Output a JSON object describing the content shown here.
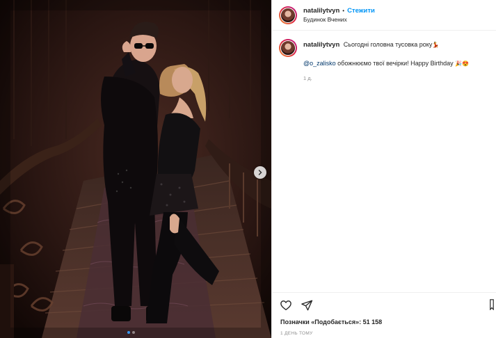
{
  "post": {
    "author": {
      "username": "natalilytvyn",
      "separator": "•",
      "follow_label": "Стежити",
      "location": "Будинок Вчених"
    },
    "caption": {
      "username": "natalilytvyn",
      "text": "Сьогодні головна тусовка року",
      "text_emoji": "💃",
      "mention": "@o_zalisko",
      "line2_text": " обожнюємо твої вечірки! Happy Birthday ",
      "line2_emoji": "🎉😍",
      "timestamp": "1 д."
    },
    "likes_text": "Позначки «Подобається»: 51 158",
    "date_text": "1 ДЕНЬ ТОМУ",
    "carousel": {
      "current": 1,
      "total": 2
    },
    "icons": {
      "like": "heart-icon",
      "share": "share-icon",
      "next": "chevron-right-icon",
      "save": "bookmark-icon"
    },
    "colors": {
      "link": "#0095f6",
      "mention": "#00376b",
      "muted": "#8e8e8e",
      "active_dot": "#3897f0"
    }
  }
}
